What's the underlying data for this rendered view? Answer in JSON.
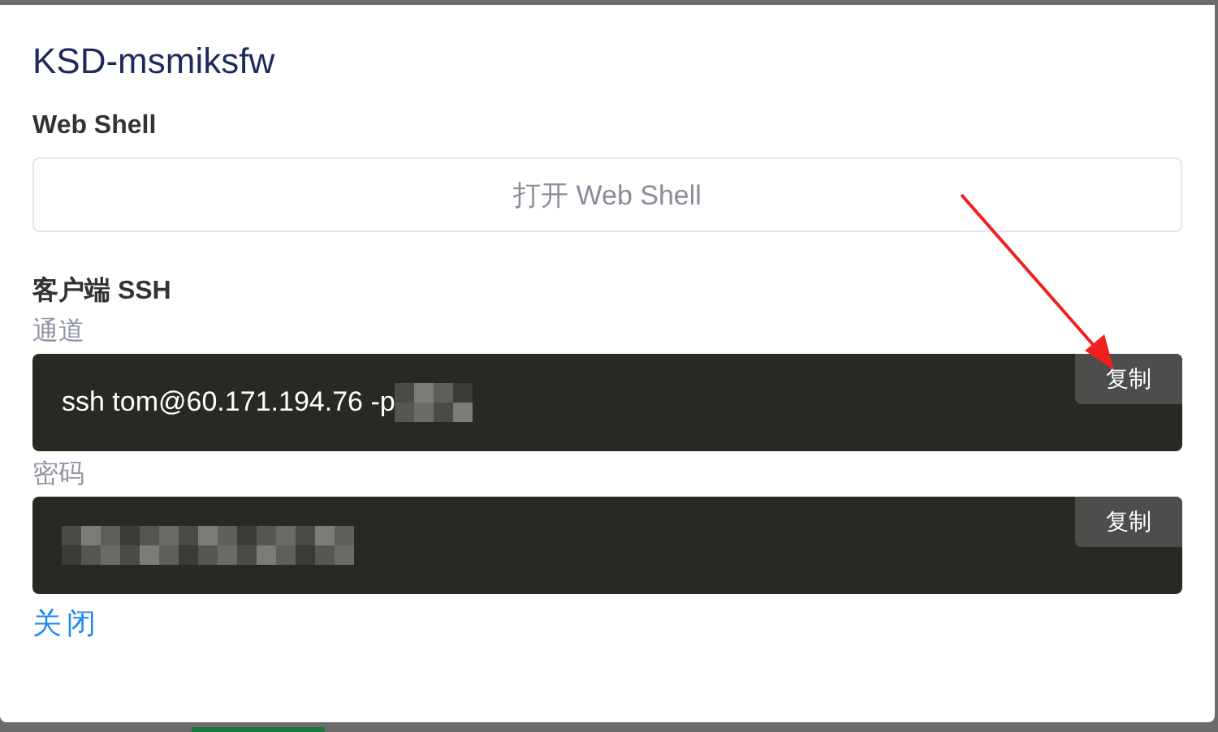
{
  "dialog": {
    "title": "KSD-msmiksfw"
  },
  "web_shell": {
    "heading": "Web Shell",
    "button": "打开 Web Shell"
  },
  "client_ssh": {
    "heading": "客户端 SSH",
    "fields": [
      {
        "label": "通道",
        "value": "ssh tom@60.171.194.76 -p",
        "redacted": true,
        "copy": "复制"
      },
      {
        "label": "密码",
        "redacted": true,
        "copy": "复制"
      }
    ]
  },
  "close": "关闭"
}
